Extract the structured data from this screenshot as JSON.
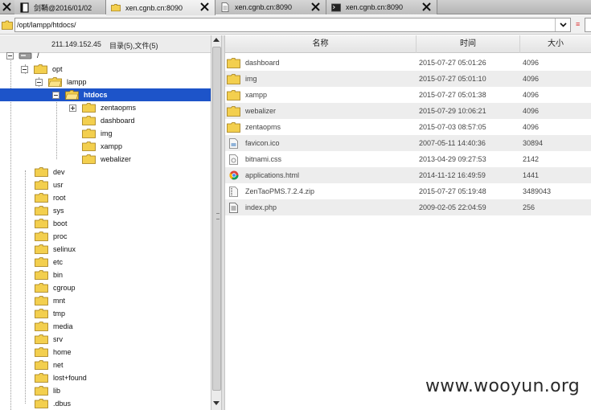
{
  "tabs": [
    {
      "label": "剑鞘@2016/01/02",
      "icon": "document-icon",
      "active": false
    },
    {
      "label": "xen.cgnb.cn:8090",
      "icon": "folder-icon",
      "active": true
    },
    {
      "label": "xen.cgnb.cn:8090",
      "icon": "document-icon",
      "active": false
    },
    {
      "label": "xen.cgnb.cn:8090",
      "icon": "terminal-icon",
      "active": false
    }
  ],
  "address": {
    "path": "/opt/lampp/htdocs/"
  },
  "left_header": {
    "ip": "211.149.152.45",
    "summary": "目录(5),文件(5)"
  },
  "tree": {
    "root": "/",
    "opt": "opt",
    "lampp": "lampp",
    "htdocs": "htdocs",
    "children": [
      "zentaopms",
      "dashboard",
      "img",
      "xampp",
      "webalizer"
    ],
    "top_dirs": [
      "dev",
      "usr",
      "root",
      "sys",
      "boot",
      "proc",
      "selinux",
      "etc",
      "bin",
      "cgroup",
      "mnt",
      "tmp",
      "media",
      "srv",
      "home",
      "net",
      "lost+found",
      "lib",
      ".dbus"
    ]
  },
  "columns": {
    "name": "名称",
    "time": "时间",
    "size": "大小"
  },
  "files": [
    {
      "name": "dashboard",
      "time": "2015-07-27 05:01:26",
      "size": "4096",
      "icon": "folder-icon"
    },
    {
      "name": "img",
      "time": "2015-07-27 05:01:10",
      "size": "4096",
      "icon": "folder-icon"
    },
    {
      "name": "xampp",
      "time": "2015-07-27 05:01:38",
      "size": "4096",
      "icon": "folder-icon"
    },
    {
      "name": "webalizer",
      "time": "2015-07-29 10:06:21",
      "size": "4096",
      "icon": "folder-icon"
    },
    {
      "name": "zentaopms",
      "time": "2015-07-03 08:57:05",
      "size": "4096",
      "icon": "folder-icon"
    },
    {
      "name": "favicon.ico",
      "time": "2007-05-11 14:40:36",
      "size": "30894",
      "icon": "image-file-icon"
    },
    {
      "name": "bitnami.css",
      "time": "2013-04-29 09:27:53",
      "size": "2142",
      "icon": "css-file-icon"
    },
    {
      "name": "applications.html",
      "time": "2014-11-12 16:49:59",
      "size": "1441",
      "icon": "chrome-html-icon"
    },
    {
      "name": "ZenTaoPMS.7.2.4.zip",
      "time": "2015-07-27 05:19:48",
      "size": "3489043",
      "icon": "zip-file-icon"
    },
    {
      "name": "index.php",
      "time": "2009-02-05 22:04:59",
      "size": "256",
      "icon": "php-file-icon"
    }
  ],
  "watermark": "www.wooyun.org",
  "colors": {
    "selection": "#1d54c9",
    "folder": "#f3cf4e",
    "alt_row": "#ededed"
  }
}
